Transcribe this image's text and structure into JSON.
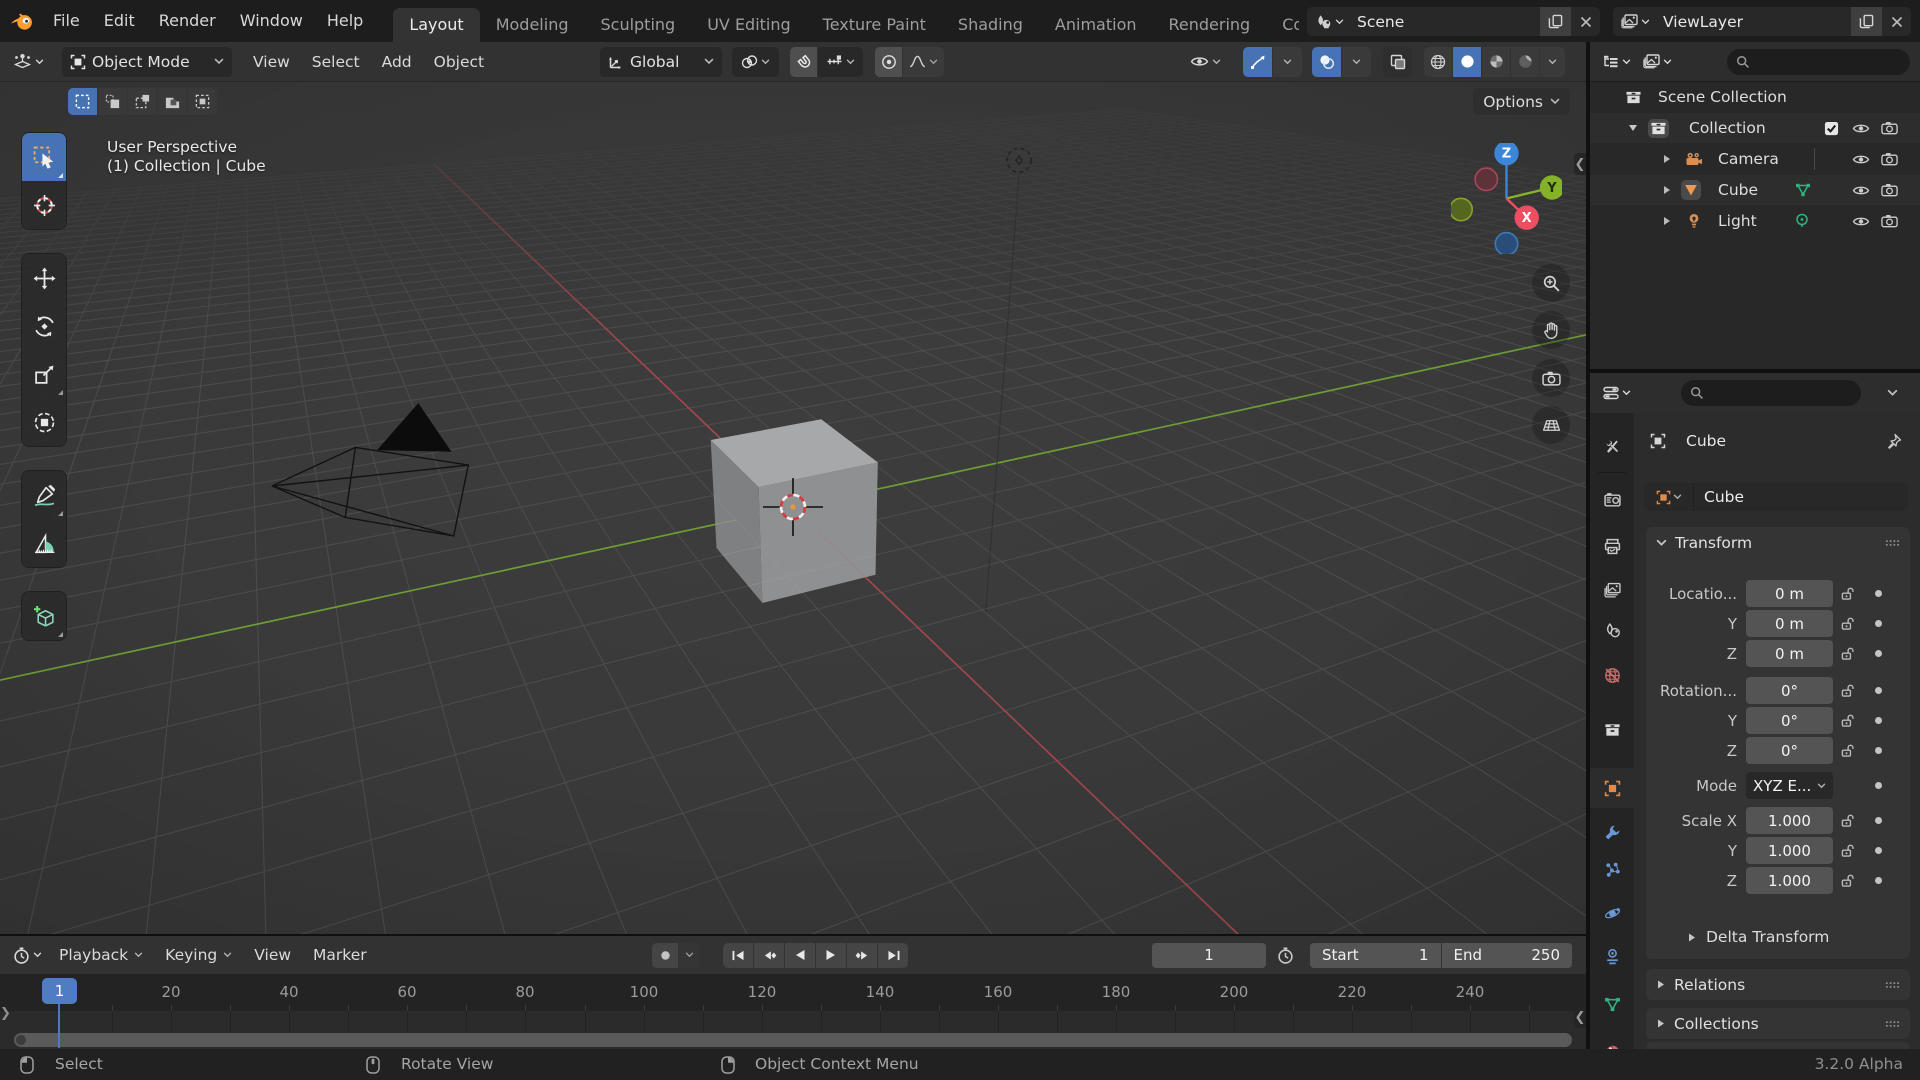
{
  "topbar": {
    "menus": [
      "File",
      "Edit",
      "Render",
      "Window",
      "Help"
    ],
    "tabs": [
      {
        "label": "Layout",
        "active": true
      },
      {
        "label": "Modeling",
        "active": false
      },
      {
        "label": "Sculpting",
        "active": false
      },
      {
        "label": "UV Editing",
        "active": false
      },
      {
        "label": "Texture Paint",
        "active": false
      },
      {
        "label": "Shading",
        "active": false
      },
      {
        "label": "Animation",
        "active": false
      },
      {
        "label": "Rendering",
        "active": false
      },
      {
        "label": "Compositing",
        "active": false
      }
    ],
    "scene_selector": {
      "value": "Scene"
    },
    "viewlayer_selector": {
      "value": "ViewLayer"
    }
  },
  "viewport": {
    "header": {
      "mode": "Object Mode",
      "menus": [
        "View",
        "Select",
        "Add",
        "Object"
      ],
      "orientation": "Global"
    },
    "tool_settings": {
      "options_label": "Options"
    },
    "overlay": {
      "view_label": "User Perspective",
      "context_label": "(1) Collection | Cube"
    },
    "gizmo": {
      "x": "X",
      "y": "Y",
      "z": "Z"
    }
  },
  "outliner": {
    "rows": [
      {
        "label": "Scene Collection",
        "type": "scene-collection"
      },
      {
        "label": "Collection",
        "type": "collection"
      },
      {
        "label": "Camera",
        "type": "camera"
      },
      {
        "label": "Cube",
        "type": "mesh"
      },
      {
        "label": "Light",
        "type": "light"
      }
    ]
  },
  "properties": {
    "breadcrumb": "Cube",
    "name_field": "Cube",
    "transform": {
      "title": "Transform",
      "location_rows": [
        {
          "label": "Locatio...",
          "value": "0 m"
        },
        {
          "label": "Y",
          "value": "0 m"
        },
        {
          "label": "Z",
          "value": "0 m"
        }
      ],
      "rotation_rows": [
        {
          "label": "Rotation...",
          "value": "0°"
        },
        {
          "label": "Y",
          "value": "0°"
        },
        {
          "label": "Z",
          "value": "0°"
        }
      ],
      "mode_label": "Mode",
      "mode_value": "XYZ E...",
      "scale_rows": [
        {
          "label": "Scale X",
          "value": "1.000"
        },
        {
          "label": "Y",
          "value": "1.000"
        },
        {
          "label": "Z",
          "value": "1.000"
        }
      ],
      "delta_label": "Delta Transform"
    },
    "panels": [
      {
        "title": "Relations"
      },
      {
        "title": "Collections"
      }
    ]
  },
  "timeline": {
    "menus": [
      {
        "label": "Playback",
        "has_chevron": true
      },
      {
        "label": "Keying",
        "has_chevron": true
      },
      {
        "label": "View",
        "has_chevron": false
      },
      {
        "label": "Marker",
        "has_chevron": false
      }
    ],
    "current_frame": "1",
    "playhead_frame": "1",
    "start_label": "Start",
    "start_value": "1",
    "end_label": "End",
    "end_value": "250",
    "ruler_labels": [
      "20",
      "40",
      "60",
      "80",
      "100",
      "120",
      "140",
      "160",
      "180",
      "200",
      "220",
      "240"
    ]
  },
  "statusbar": {
    "hints": [
      {
        "label": "Select",
        "button": "left-mouse"
      },
      {
        "label": "Rotate View",
        "button": "middle-mouse"
      },
      {
        "label": "Object Context Menu",
        "button": "right-mouse"
      }
    ],
    "version": "3.2.0 Alpha"
  }
}
